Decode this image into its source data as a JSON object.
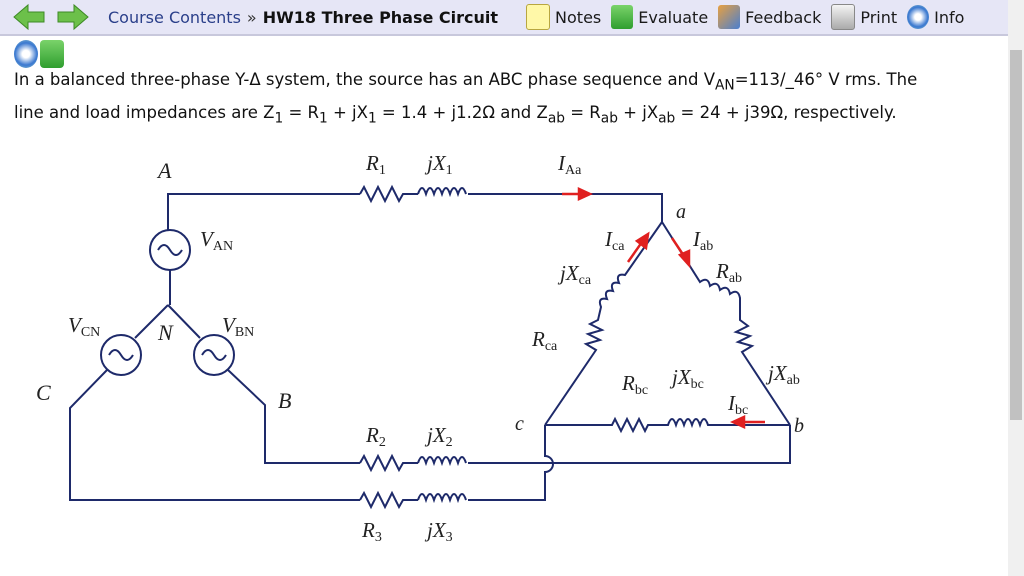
{
  "toolbar": {
    "back_icon": "back-arrow-icon",
    "forward_icon": "forward-arrow-icon",
    "breadcrumb": "Course Contents",
    "separator": "»",
    "title": "HW18 Three Phase Circuit",
    "items": [
      {
        "label": "Notes",
        "icon": "notes-icon"
      },
      {
        "label": "Evaluate",
        "icon": "thumbs-up-icon"
      },
      {
        "label": "Feedback",
        "icon": "feedback-icon"
      },
      {
        "label": "Print",
        "icon": "printer-icon"
      },
      {
        "label": "Info",
        "icon": "info-icon"
      }
    ]
  },
  "problem": {
    "line1_pre": "In a balanced three-phase Y-Δ system, the source has an ABC phase sequence and V",
    "line1_sub": "AN",
    "line1_post": "=113/_46° V rms. The",
    "line2_a": "line and load impedances are Z",
    "s1": "1",
    "line2_b": " = R",
    "s2": "1",
    "line2_c": " + jX",
    "s3": "1",
    "line2_d": " = 1.4 + j1.2Ω and Z",
    "s4": "ab",
    "line2_e": " = R",
    "s5": "ab",
    "line2_f": " + jX",
    "s6": "ab",
    "line2_g": " = 24 + j39Ω, respectively."
  },
  "circuit": {
    "A": "A",
    "B": "B",
    "C": "C",
    "N": "N",
    "a": "a",
    "b": "b",
    "c": "c",
    "VAN": "V",
    "VAN_sub": "AN",
    "VBN": "V",
    "VBN_sub": "BN",
    "VCN": "V",
    "VCN_sub": "CN",
    "R1": "R",
    "R1_sub": "1",
    "jX1": "jX",
    "jX1_sub": "1",
    "R2": "R",
    "R2_sub": "2",
    "jX2": "jX",
    "jX2_sub": "2",
    "R3": "R",
    "R3_sub": "3",
    "jX3": "jX",
    "jX3_sub": "3",
    "IAa": "I",
    "IAa_sub": "Aa",
    "Ica": "I",
    "Ica_sub": "ca",
    "Iab": "I",
    "Iab_sub": "ab",
    "Ibc": "I",
    "Ibc_sub": "bc",
    "Rab": "R",
    "Rab_sub": "ab",
    "jXab": "jX",
    "jXab_sub": "ab",
    "Rca": "R",
    "Rca_sub": "ca",
    "jXca": "jX",
    "jXca_sub": "ca",
    "Rbc": "R",
    "Rbc_sub": "bc",
    "jXbc": "jX",
    "jXbc_sub": "bc",
    "current_arrow_color": "#e02020"
  }
}
